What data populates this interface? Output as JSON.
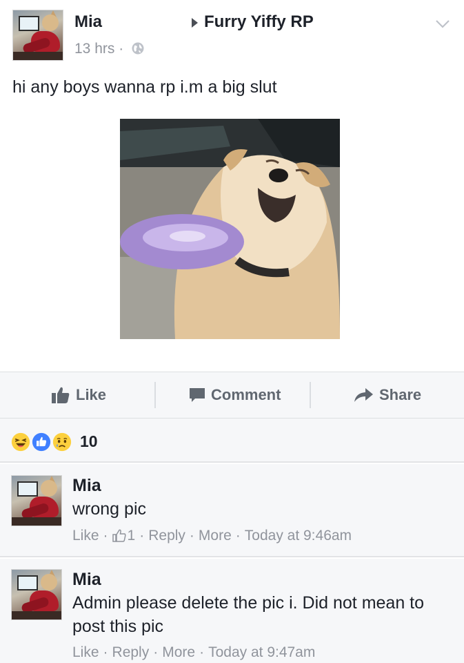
{
  "post": {
    "author": "Mia",
    "group": "Furry Yiffy RP",
    "time": "13 hrs",
    "time_separator": "·",
    "text": "hi any boys wanna rp i.m a big slut"
  },
  "actions": {
    "like_label": "Like",
    "comment_label": "Comment",
    "share_label": "Share"
  },
  "reactions": {
    "icons": [
      "haha-icon",
      "like-icon",
      "sad-icon"
    ],
    "count": "10"
  },
  "comments": [
    {
      "author": "Mia",
      "text": "wrong pic",
      "like_label": "Like",
      "like_count": "1",
      "reply_label": "Reply",
      "more_label": "More",
      "time": "Today at 9:46am"
    },
    {
      "author": "Mia",
      "text": "Admin please delete the pic i. Did not mean to post this pic",
      "like_label": "Like",
      "reply_label": "Reply",
      "more_label": "More",
      "time": "Today at 9:47am"
    }
  ],
  "colors": {
    "text_primary": "#1d2129",
    "text_secondary": "#90949c",
    "action_gray": "#606770",
    "like_blue": "#4080ff",
    "reaction_yellow": "#fcd03e",
    "background_gray": "#f6f7f9"
  }
}
